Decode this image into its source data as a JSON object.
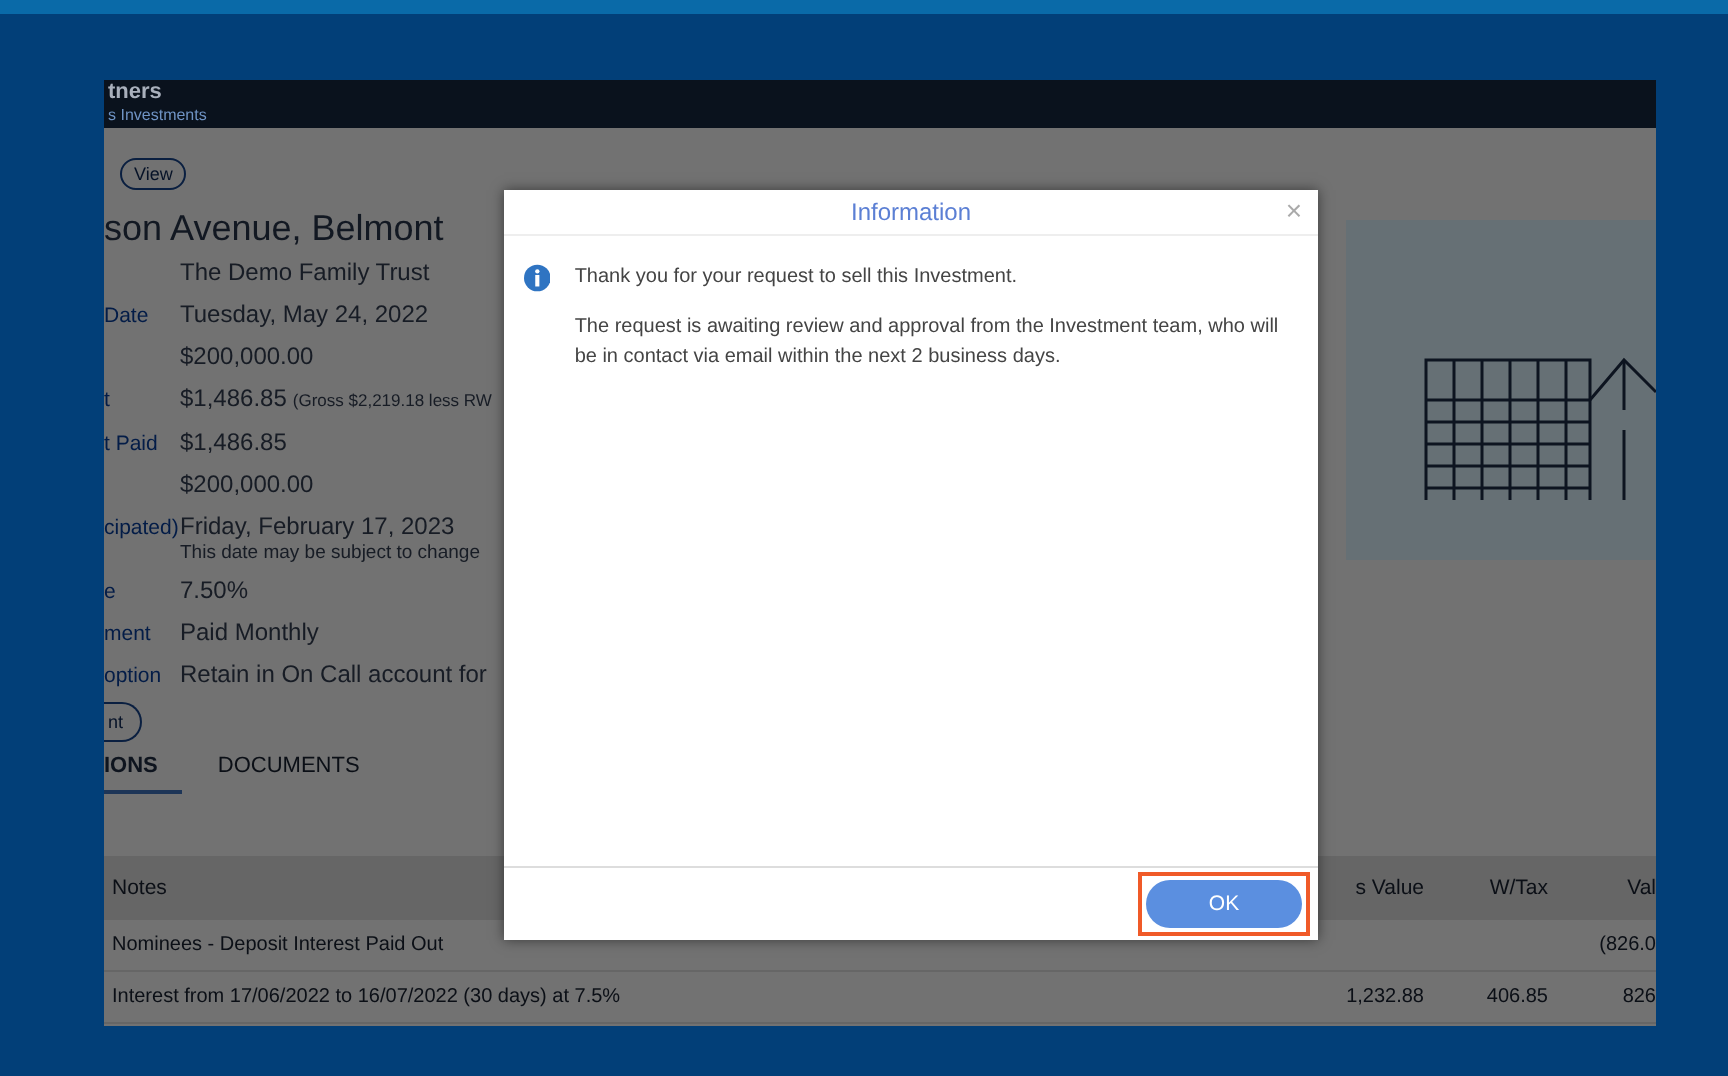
{
  "header": {
    "brand": "tners",
    "tagline": "s Investments"
  },
  "view_button": "View",
  "title": "son Avenue, Belmont",
  "details": [
    {
      "value": "The Demo Family Trust"
    },
    {
      "label": "Date",
      "value": "Tuesday, May 24, 2022"
    },
    {
      "value": "$200,000.00"
    },
    {
      "label": "t",
      "value": "$1,486.85",
      "note": "(Gross $2,219.18 less RW"
    },
    {
      "label": "t Paid",
      "value": "$1,486.85"
    },
    {
      "value": "$200,000.00"
    },
    {
      "label": "cipated)",
      "value": "Friday, February 17, 2023",
      "subnote": "This date may be subject to change"
    },
    {
      "label": "e",
      "value": "7.50%"
    },
    {
      "label": "ment",
      "value": "Paid Monthly"
    },
    {
      "label": "option",
      "value": "Retain in On Call account for"
    }
  ],
  "action_button": "nt",
  "tabs": [
    {
      "label": "IONS",
      "selected": true
    },
    {
      "label": "DOCUMENTS",
      "selected": false
    }
  ],
  "table": {
    "columns": [
      "Notes",
      "s Value",
      "W/Tax",
      "Val"
    ],
    "rows": [
      [
        "Nominees - Deposit Interest Paid Out",
        null,
        null,
        "(826.0"
      ],
      [
        "Interest from 17/06/2022 to 16/07/2022 (30 days) at 7.5%",
        "1,232.88",
        "406.85",
        "826"
      ]
    ]
  },
  "dialog": {
    "title": "Information",
    "close": "×",
    "paragraphs": [
      "Thank you for your request to sell this Investment.",
      "The request is awaiting review and approval from the Investment team, who will be in contact via email within the next 2 business days."
    ],
    "ok_button": "OK",
    "ok_highlighted": true
  }
}
